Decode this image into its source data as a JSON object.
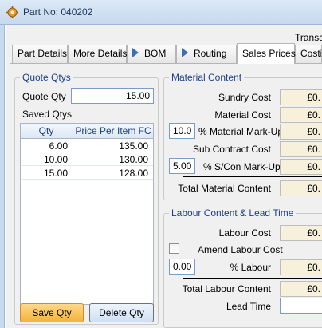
{
  "window": {
    "title": "Part No: 040202"
  },
  "header": {
    "transac_label": "Transac"
  },
  "tabs": [
    {
      "label": "Part Details"
    },
    {
      "label": "More Details"
    },
    {
      "label": "BOM"
    },
    {
      "label": "Routing"
    },
    {
      "label": "Sales Prices"
    },
    {
      "label": "Costin"
    }
  ],
  "quote": {
    "legend": "Quote Qtys",
    "quote_qty_label": "Quote Qty",
    "quote_qty_value": "15.00",
    "saved_label": "Saved Qtys",
    "columns": [
      "Qty",
      "Price Per Item FC"
    ],
    "rows": [
      {
        "qty": "6.00",
        "price": "135.00"
      },
      {
        "qty": "10.00",
        "price": "130.00"
      },
      {
        "qty": "15.00",
        "price": "128.00"
      }
    ],
    "save_label": "Save Qty",
    "delete_label": "Delete Qty"
  },
  "material": {
    "legend": "Material Content",
    "sundry_label": "Sundry Cost",
    "sundry_value": "£0.",
    "material_cost_label": "Material Cost",
    "material_cost_value": "£0.",
    "markup_value": "10.00",
    "markup_label": "% Material Mark-Up",
    "markup_amount": "£0.",
    "subcontract_label": "Sub Contract Cost",
    "subcontract_value": "£0.",
    "scon_value": "5.00",
    "scon_label": "% S/Con Mark-Up",
    "scon_amount": "£0.",
    "total_label": "Total Material Content",
    "total_value": "£0."
  },
  "labour": {
    "legend": "Labour Content & Lead Time",
    "labour_cost_label": "Labour Cost",
    "labour_cost_value": "£0.",
    "amend_label": "Amend Labour Cost",
    "percent_value": "0.00",
    "percent_label": "% Labour",
    "percent_amount": "£0.",
    "total_label": "Total Labour Content",
    "total_value": "£0.",
    "lead_time_label": "Lead Time",
    "lead_time_value": ""
  },
  "colors": {
    "accent": "#1e3f8a",
    "save_button": "#f4b33c",
    "money_field": "#f7f1dc"
  }
}
